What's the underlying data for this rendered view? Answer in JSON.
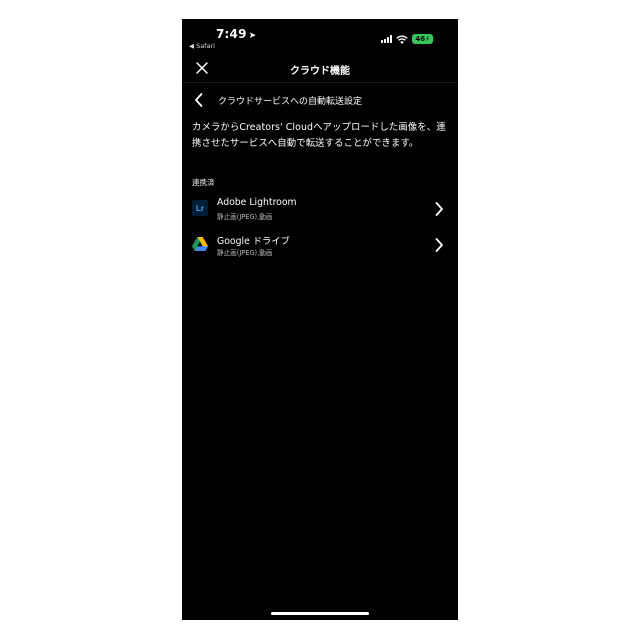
{
  "status_bar": {
    "time": "7:49",
    "location_arrow": "➤",
    "back_app": "◀ Safari",
    "battery": "46"
  },
  "header": {
    "title": "クラウド機能",
    "close_icon": "close-icon"
  },
  "sub_header": {
    "title": "クラウドサービスへの自動転送設定",
    "back_icon": "chevron-left-icon"
  },
  "description": "カメラからCreators' Cloudへアップロードした画像を、連携させたサービスへ自動で転送することができます。",
  "section_label": "連携済",
  "services": [
    {
      "name": "Adobe Lightroom",
      "subtitle": "静止画(JPEG),動画",
      "icon": "lightroom-icon",
      "icon_text": "Lr"
    },
    {
      "name": "Google ドライブ",
      "subtitle": "静止画(JPEG),動画",
      "icon": "google-drive-icon"
    }
  ],
  "colors": {
    "background": "#000000",
    "battery": "#34c759",
    "lightroom_bg": "#001e36",
    "lightroom_text": "#31a8ff"
  }
}
